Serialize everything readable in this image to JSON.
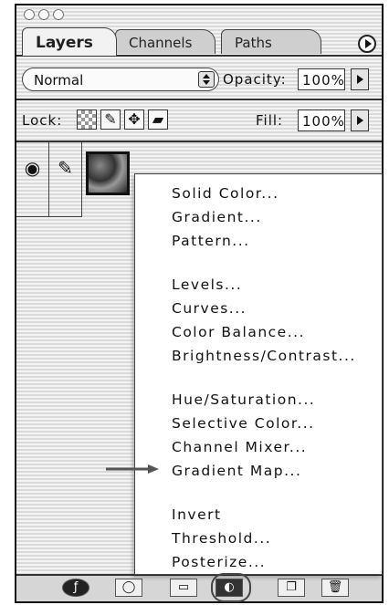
{
  "tabs": [
    "Layers",
    "Channels",
    "Paths"
  ],
  "blend": {
    "mode": "Normal",
    "opacity_label": "Opacity:",
    "opacity_value": "100%"
  },
  "lock": {
    "label": "Lock:",
    "fill_label": "Fill:",
    "fill_value": "100%"
  },
  "menu": {
    "items": [
      "Solid Color...",
      "Gradient...",
      "Pattern...",
      "Levels...",
      "Curves...",
      "Color Balance...",
      "Brightness/Contrast...",
      "Hue/Saturation...",
      "Selective Color...",
      "Channel Mixer...",
      "Gradient Map...",
      "Invert",
      "Threshold...",
      "Posterize..."
    ],
    "highlighted": "Gradient Map..."
  },
  "icons": {
    "eye": "eye-icon",
    "brush": "brush-icon",
    "lock_transparent": "checker-icon",
    "lock_paint": "brush-icon",
    "lock_move": "move-icon",
    "lock_all": "lock-icon",
    "panel_menu": "panel-menu-arrow-icon"
  }
}
